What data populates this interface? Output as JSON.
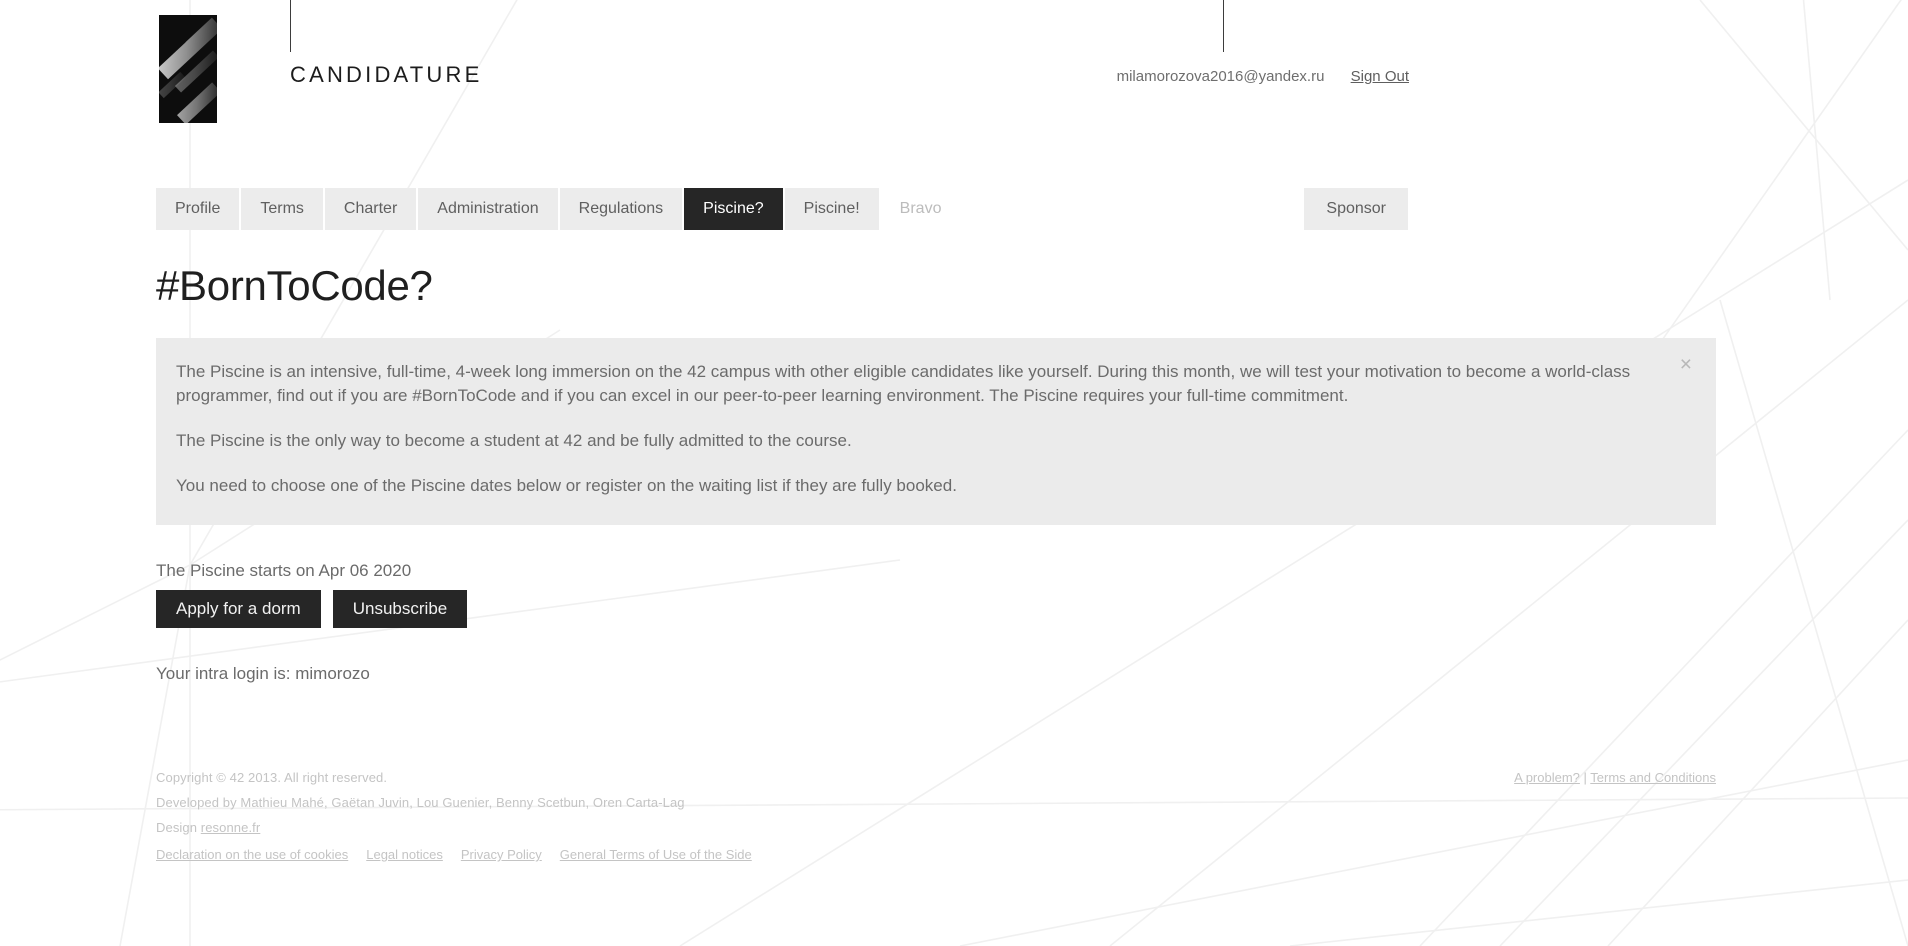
{
  "header": {
    "logo_name": "42-logo",
    "brand_title": "CANDIDATURE",
    "account_email": "milamorozova2016@yandex.ru",
    "sign_out_label": "Sign Out"
  },
  "nav": {
    "items": [
      {
        "label": "Profile",
        "state": "normal"
      },
      {
        "label": "Terms",
        "state": "normal"
      },
      {
        "label": "Charter",
        "state": "normal"
      },
      {
        "label": "Administration",
        "state": "normal"
      },
      {
        "label": "Regulations",
        "state": "normal"
      },
      {
        "label": "Piscine?",
        "state": "active"
      },
      {
        "label": "Piscine!",
        "state": "normal"
      },
      {
        "label": "Bravo",
        "state": "disabled"
      }
    ],
    "sponsor_label": "Sponsor"
  },
  "main": {
    "page_title": "#BornToCode?",
    "info_panel": {
      "close_label": "×",
      "paragraphs": [
        "The Piscine is an intensive, full-time, 4-week long immersion on the 42 campus with other eligible candidates like yourself. During this month, we will test your motivation to become a world-class programmer, find out if you are #BornToCode and if you can excel in our peer-to-peer learning environment. The Piscine requires your full-time commitment.",
        "The Piscine is the only way to become a student at 42 and be fully admitted to the course.",
        "You need to choose one of the Piscine dates below or register on the waiting list if they are fully booked."
      ]
    },
    "start_text": "The Piscine starts on Apr 06 2020",
    "apply_dorm_label": "Apply for a dorm",
    "unsubscribe_label": "Unsubscribe",
    "intra_login_text": "Your intra login is: mimorozo"
  },
  "footer": {
    "copyright": "Copyright © 42 2013. All right reserved.",
    "developed_by": "Developed by Mathieu Mahé, Gaëtan Juvin, Lou Guenier, Benny Scetbun, Oren Carta-Lag",
    "design_prefix": "Design ",
    "design_link": "resonne.fr",
    "links": [
      "Declaration on the use of cookies",
      "Legal notices",
      "Privacy Policy",
      "General Terms of Use of the Side"
    ],
    "right_problem": "A problem?",
    "right_separator": " | ",
    "right_terms": "Terms and Conditions"
  },
  "colors": {
    "accent_dark": "#262626",
    "panel_bg": "#ebebeb",
    "nav_bg": "#ececec",
    "text_muted": "#6b6b6b"
  }
}
